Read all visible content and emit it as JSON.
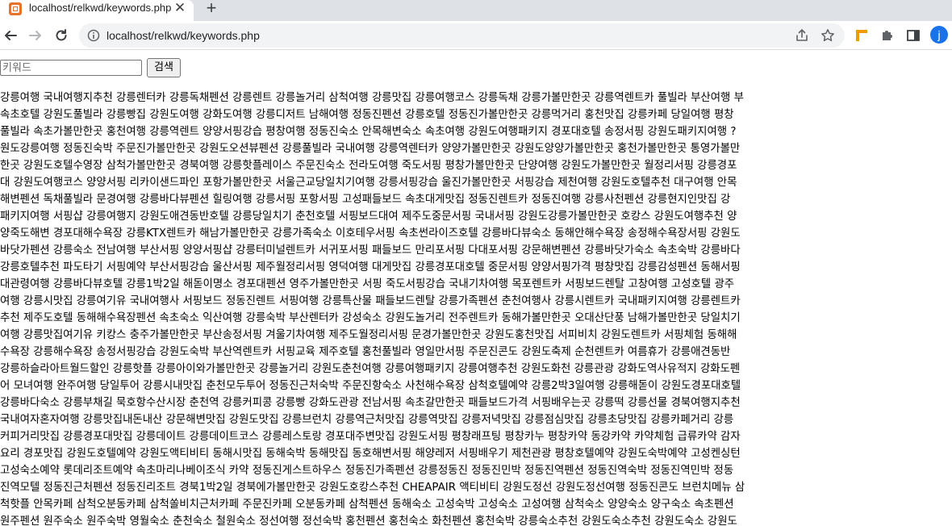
{
  "browser": {
    "tab_title": "localhost/relkwd/keywords.php",
    "tab_close": "✕",
    "new_tab": "+",
    "url": "localhost/relkwd/keywords.php",
    "profile_initial": "j",
    "colors": {
      "tabstrip": "#dee1e6",
      "favicon": "#e8742c",
      "profile": "#1a73e8"
    }
  },
  "page": {
    "search_placeholder": "키워드",
    "search_value": "",
    "search_button": "검색",
    "keyword_lines": [
      "강릉여행 국내여행지추천 강릉렌터카 강릉독채펜션 강릉렌트 강릉놀거리 삼척여행 강릉맛집 강릉여행코스 강릉독채 강릉가볼만한곳 강릉역렌트카 풀빌라 부산여행 부",
      "속초호텔 강원도풀빌라 강릉빵집 강원도여행 강화도여행 강릉디저트 남해여행 정동진펜션 강릉호텔 정동진가볼만한곳 강릉먹거리 홍천맛집 강릉카페 당일여행 평창",
      "풀빌라 속초가볼만한곳 홍천여행 강릉역렌트 양양서핑강습 평창여행 정동진숙소 안목해변숙소 속초여행 강원도여행패키지 경포대호텔 송정서핑 강원도패키지여행 ?",
      "원도강릉여행 정동진숙박 주문진가볼만한곳 강원도오션뷰펜션 강릉풀빌라 국내여행 강릉역렌터카 양양가볼만한곳 강원도양양가볼만한곳 홍천가볼만한곳 통영가볼만",
      "한곳 강원도호텔수영장 삼척가볼만한곳 경북여행 강릉핫플레이스 주문진숙소 전라도여행 죽도서핑 평창가볼만한곳 단양여행 강원도가볼만한곳 월정리서핑 강릉경포",
      "대 강원도여행코스 양양서핑 리카이샌드파인 포항가볼만한곳 서울근교당일치기여행 강릉서핑강습 울진가볼만한곳 서핑강습 제천여행 강원도호텔추천 대구여행 안목",
      "해변펜션 독채풀빌라 문경여행 강릉바다뷰펜션 힐링여행 강릉서핑 포항서핑 고성패들보드 속초대게맛집 정동진렌트카 정동진여행 강릉사천펜션 강릉현지인맛집 강",
      "패키지여행 서핑샵 강릉여행지 강원도애견동반호텔 강릉당일치기 춘천호텔 서핑보드대여 제주도중문서핑 국내서핑 강원도강릉가볼만한곳 호캉스 강원도여행추천 양",
      "양죽도해변 경포대해수욕장 강릉KTX렌트카 해남가볼만한곳 강릉가족숙소 이호테우서핑 속초썬라이즈호텔 강릉바다뷰숙소 동해안해수욕장 송정해수욕장서핑 강원도",
      "바닷가펜션 강릉숙소 전남여행 부산서핑 양양서핑샵 강릉터미널렌트카 서귀포서핑 패들보드 만리포서핑 다대포서핑 강문해변펜션 강릉바닷가숙소 속초숙박 강릉바다",
      "강릉호텔추천 파도타기 서핑예약 부산서핑강습 울산서핑 제주월정리서핑 영덕여행 대게맛집 강릉경포대호텔 중문서핑 양양서핑가격 평창맛집 강릉감성펜션 동해서핑",
      "대관령여행 강릉바다뷰호텔 강릉1박2일 해돋이명소 경포대펜션 영주가볼만한곳 서핑 죽도서핑강습 국내기차여행 목포렌트카 서핑보드렌탈 고창여행 고성호텔 광주",
      "여행 강릉시맛집 강릉여기유 국내여행사 서핑보드 정동진렌트 서핑여행 강릉특산물 패들보드렌탈 강릉가족펜션 춘천여행사 강릉시렌트카 국내패키지여행 강릉렌트카",
      "추천 제주도호텔 동해해수욕장펜션 속초숙소 익산여행 강릉숙박 부산렌터카 강성숙소 강원도놀거리 전주렌트카 동해가볼만한곳 오대산단풍 남해가볼만한곳 당일치기",
      "여행 강릉맛집여기유 키캉스 충주가볼만한곳 부산송정서핑 겨울기차여행 제주도월정리서핑 문경가볼만한곳 강원도홍천맛집 서피비치 강원도렌트카 서핑체험 동해해",
      "수욕장 강릉해수욕장 송정서핑강습 강원도숙박 부산역렌트카 서핑교육 제주호텔 홍천풀빌라 영일만서핑 주문진콘도 강원도축제 순천렌트카 여름휴가 강릉애견동반",
      "강릉하슬라아트월드할인 강릉핫플 강릉아이와가볼만한곳 강릉놀거리 강원도춘천여행 강릉여행패키지 강릉여행추천 강원도화천 강릉관광 강화도역사유적지 강화도펜",
      "어 모녀여행 완주여행 당일투어 강릉시내맛집 춘천모두투어 정동진근처숙박 주문진항숙소 사천해수욕장 삼척호텔예약 강릉2박3일여행 강릉해돋이 강원도경포대호텔",
      "강릉바다숙소 강릉부채길 묵호항수산시장 춘천역 강릉커피콩 강릉빵 강화도관광 전남서핑 속초갈만한곳 패들보드가격 서핑배우는곳 강릉떡 강릉선물 경북여행지추천",
      "국내여자혼자여행 강릉맛집내돈내산 강문해변맛집 강원도맛집 강릉브런치 강릉역근처맛집 강릉역맛집 강릉저녁맛집 강릉점심맛집 강릉초당맛집 강릉카페거리 강릉",
      "커피거리맛집 강릉경포대맛집 강릉데이트 강릉데이트코스 강릉레스토랑 경포대주변맛집 강원도서핑 평창래프팅 평창카누 평창카약 동강카약 카약체험 급류카약 감자",
      "요리 경포맛집 강원도호텔예약 강원도액티비티 동해시맛집 동해숙박 동해맛집 동호해변서핑 해양레저 서핑배우기 제천관광 평창호텔예약 강원도숙박예약 고성켄싱턴",
      "고성숙소예약 롯데리조트예약 속초마리나베이조식 카약 정동진게스트하우스 정동진가족펜션 강릉정동진 정동진민박 정동진역펜션 정동진역숙박 정동진역민박 정동",
      "진역모텔 정동진근처펜션 정동진리조트 경북1박2일 경북에가볼만한곳 강원도호캉스추천 CHEAPAIR 액티비티 강원도정선 강원도정선여행 정동진콘도 브런치메뉴 삼",
      "척핫플 안목카페 삼척오분동카페 삼척쏠비치근처카페 주문진카페 오분동카페 삼척펜션 동해숙소 고성숙박 고성숙소 고성여행 삼척숙소 양양숙소 양구숙소 속초펜션",
      "원주펜션 원주숙소 원주숙박 영월숙소 춘천숙소 철원숙소 정선여행 정선숙박 홍천펜션 홍천숙소 화천펜션 홍천숙박 강릉숙소추천 강원도숙소추천 강원도숙소 강원도"
    ]
  }
}
